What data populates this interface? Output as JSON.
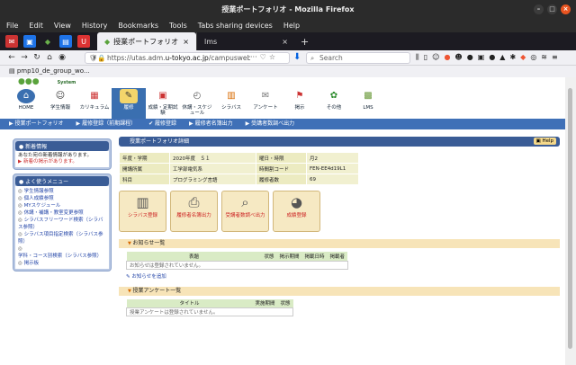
{
  "window": {
    "title": "授業ポートフォリオ - Mozilla Firefox"
  },
  "menubar": [
    "File",
    "Edit",
    "View",
    "History",
    "Bookmarks",
    "Tools",
    "Tabs sharing devices",
    "Help"
  ],
  "tabs": [
    {
      "label": "授業ポートフォリオ"
    },
    {
      "label": "lms"
    }
  ],
  "nav": {
    "url_prefix": "https://utas.adm.",
    "url_domain": "u-tokyo.ac.jp",
    "url_rest": "/campusweb",
    "search_placeholder": "Search"
  },
  "bookmarks": {
    "item": "pmp10_de_group_wo..."
  },
  "logo": {
    "sub": "System"
  },
  "top_icons": [
    "HOME",
    "学生情報",
    "カリキュラム",
    "履修",
    "成績・定期試験",
    "休講・スケジュール",
    "シラバス",
    "アンケート",
    "掲示",
    "その他",
    "LMS"
  ],
  "top_bar": [
    "授業ポートフォリオ",
    "履修登録（前期課程）",
    "履修登録",
    "履修者名簿出力",
    "受講者数調べ出力"
  ],
  "sidebar": {
    "news_title": "新着情報",
    "news_text": "あなた宛の新着情報があります。",
    "news_link": "新着の掲示があります。",
    "menu_title": "よく使うメニュー",
    "menu_items": [
      "学生情報参照",
      "個人成績参照",
      "MYスケジュール",
      "休講・補講・教室変更参照",
      "シラバスフリーワード検索（シラバス参照）",
      "シラバス項目指定検索（シラバス参照）",
      "学科・コース別検索（シラバス参照）",
      "掲示板"
    ]
  },
  "main": {
    "panel_title": "授業ポートフォリオ詳細",
    "help": "Help",
    "info": [
      [
        "年度・学期",
        "2020年度　Ｓ１",
        "曜日・時限",
        "月2"
      ],
      [
        "開講所属",
        "工学部電気系",
        "時間割コード",
        "FEN-EE4d19L1"
      ],
      [
        "科目",
        "プログラミング言語",
        "履修者数",
        "69"
      ]
    ],
    "actions": [
      "シラバス登録",
      "履修者名簿出力",
      "受講者数調べ出力",
      "成績登録"
    ],
    "notice_title": "お知らせ一覧",
    "notice_headers": [
      "表題",
      "状態",
      "掲示期間",
      "掲載日時",
      "掲載者"
    ],
    "notice_empty": "お知らせは登録されていません。",
    "notice_add": "お知らせを追加",
    "survey_title": "授業アンケート一覧",
    "survey_headers": [
      "タイトル",
      "実施期間",
      "状態"
    ],
    "survey_empty": "授業アンケートは登録されていません。"
  }
}
